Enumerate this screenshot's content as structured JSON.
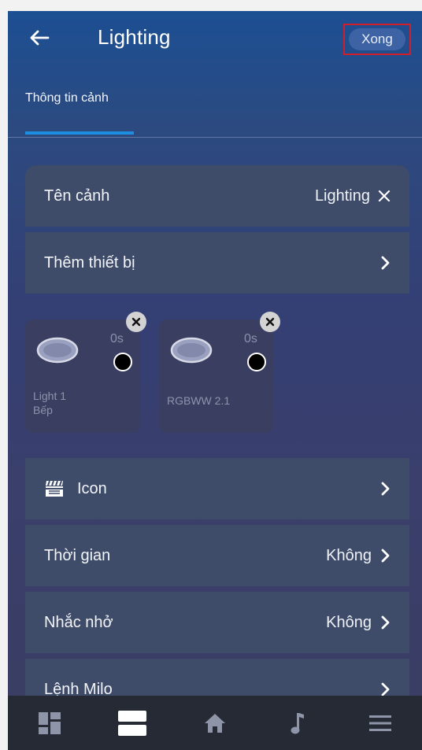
{
  "header": {
    "title": "Lighting",
    "back_icon": "arrow-left-icon",
    "done_label": "Xong"
  },
  "tabs": [
    {
      "label": "Thông tin cảnh",
      "active": true
    }
  ],
  "scene_name": {
    "label": "Tên cảnh",
    "value": "Lighting",
    "clear_icon": "close-icon"
  },
  "add_device": {
    "label": "Thêm thiết bị",
    "icon": "chevron-right-icon"
  },
  "devices": [
    {
      "delay": "0s",
      "name": "Light 1",
      "room": "Bếp",
      "icon": "ceiling-light-icon"
    },
    {
      "delay": "0s",
      "name": "RGBWW 2.1",
      "room": "",
      "icon": "ceiling-light-icon"
    }
  ],
  "settings": [
    {
      "label": "Icon",
      "value": "",
      "icon": "clapperboard-icon"
    },
    {
      "label": "Thời gian",
      "value": "Không"
    },
    {
      "label": "Nhắc nhở",
      "value": "Không"
    },
    {
      "label": "Lệnh Milo",
      "value": ""
    }
  ],
  "bottom_nav": [
    {
      "icon": "dashboard-icon",
      "active": false
    },
    {
      "icon": "scenes-icon",
      "active": true
    },
    {
      "icon": "home-icon",
      "active": false
    },
    {
      "icon": "music-icon",
      "active": false
    },
    {
      "icon": "menu-icon",
      "active": false
    }
  ],
  "colors": {
    "accent": "#1e8fe0",
    "row_background": "#3e4c6a",
    "highlight_box": "#d11f2a",
    "nav_background": "#262a35"
  }
}
